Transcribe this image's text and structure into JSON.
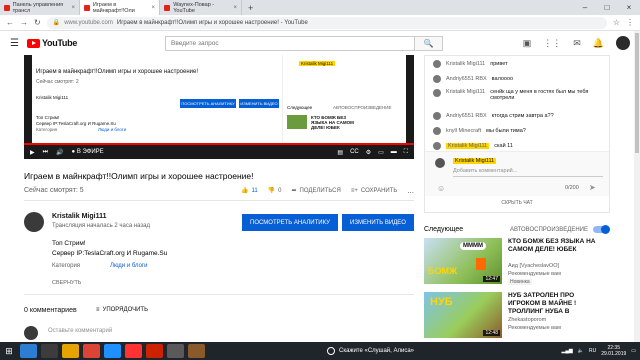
{
  "browser": {
    "tabs": [
      {
        "label": "Панель управления трансл",
        "active": false
      },
      {
        "label": "Играем в майнкрафт!!Оли",
        "active": true
      },
      {
        "label": "Waynex-Повар - YouTube",
        "active": false
      }
    ],
    "new_tab": "+",
    "url_host": "www.youtube.com",
    "url_title": "Играем в майнкрафт!!Олимп игры и хорошее настроение! - YouTube"
  },
  "youtube": {
    "logo_text": "YouTube",
    "search_placeholder": "Введите запрос"
  },
  "player": {
    "inner_title": "Играем в майнкрафт!!Олимп игры и хорошее настроение!",
    "inner_watching": "Сейчас смотрят: 2",
    "inner_author": "Kristalik Migi111",
    "inner_desc1": "Топ Стрим!",
    "inner_desc2": "Сервер IP:TeslaCraft.org И Rugame.Su",
    "inner_category": "Категория",
    "inner_category_val": "Люди и блоги",
    "inner_analytics": "ПОСМОТРЕТЬ АНАЛИТИКУ",
    "inner_edit": "ИЗМЕНИТЬ ВИДЕО",
    "inner_chip": "Kristalik Migi111",
    "inner_next": "Следующее",
    "inner_autoplay": "АВТОВОСПРОИЗВЕДЕНИЕ",
    "inner_rec_title": "КТО БОМЖ БЕЗ ЯЗЫКА НА САМОМ ДЕЛЕ! ЮБЕК",
    "live_label": "В ЭФИРЕ",
    "progress": 1.0
  },
  "video": {
    "title": "Играем в майнкрафт!!Олимп игры и хорошее настроение!",
    "watching": "Сейчас смотрят: 5",
    "likes": "11",
    "dislikes": "0",
    "share": "ПОДЕЛИТЬСЯ",
    "save": "СОХРАНИТЬ",
    "more": "..."
  },
  "channel": {
    "name": "Kristalik Migi111",
    "started": "Трансляция началась 2 часа назад",
    "analytics_btn": "ПОСМОТРЕТЬ АНАЛИТИКУ",
    "edit_btn": "ИЗМЕНИТЬ ВИДЕО"
  },
  "description": {
    "line1": "Топ Стрим!",
    "line2": "Сервер IP:TeslaCraft.org И  Rugame.Su",
    "category_label": "Категория",
    "category_value": "Люди и блоги",
    "collapse": "СВЕРНУТЬ"
  },
  "comments": {
    "count": "0 комментариев",
    "sort": "УПОРЯДОЧИТЬ",
    "add_placeholder": "Оставьте комментарий"
  },
  "chat": {
    "messages": [
      {
        "author": "Kristalik Migi111",
        "text": "привет",
        "highlight": false
      },
      {
        "author": "Andriy6551 RBX",
        "text": "валоооо",
        "highlight": false
      },
      {
        "author": "Kristalik Migi111",
        "text": "сенйк ща у меня в гостях был мы тебя смотрели",
        "highlight": false
      },
      {
        "author": "Andriy6551 RBX",
        "text": "ктогда стрим завтра а??",
        "highlight": false
      },
      {
        "author": "knyll Minecraft",
        "text": "мы были тима?",
        "highlight": false
      },
      {
        "author": "Kristalik Migi111",
        "text": "скай 11",
        "highlight": true
      }
    ],
    "input_name": "Kristalik Migi111",
    "input_placeholder": "Добавить комментарий...",
    "char_count": "0/200",
    "hide": "СКРЫТЬ ЧАТ"
  },
  "sidebar": {
    "next_label": "Следующее",
    "autoplay_label": "АВТОВОСПРОИЗВЕДЕНИЕ",
    "recommendations": [
      {
        "title": "КТО БОМЖ БЕЗ ЯЗЫКА НА САМОМ ДЕЛЕ! ЮБЕК",
        "channel": "Аид [VyacheslavOO]",
        "views": "Рекомендуемые вам",
        "badge": "Новинка",
        "duration": "12:47",
        "thumb_label": "БОМЖ",
        "thumb_top": "ММММ"
      },
      {
        "title": "НУБ ЗАТРОЛЕН ПРО ИГРОКОМ В МАЙНЕ ! ТРОЛЛИНГ НУБА В",
        "channel": "Zhekastoporom",
        "views": "Рекомендуемые вам",
        "badge": "",
        "duration": "12:48",
        "thumb_label": "НУБ",
        "thumb_top": ""
      }
    ]
  },
  "taskbar": {
    "cortana": "Скажите «Слушай, Алиса»",
    "lang": "RU",
    "time": "22:35",
    "date": "29.01.2019"
  },
  "colors": {
    "accent": "#065fd4",
    "brand": "#ff0000",
    "highlight": "#ffd600"
  }
}
